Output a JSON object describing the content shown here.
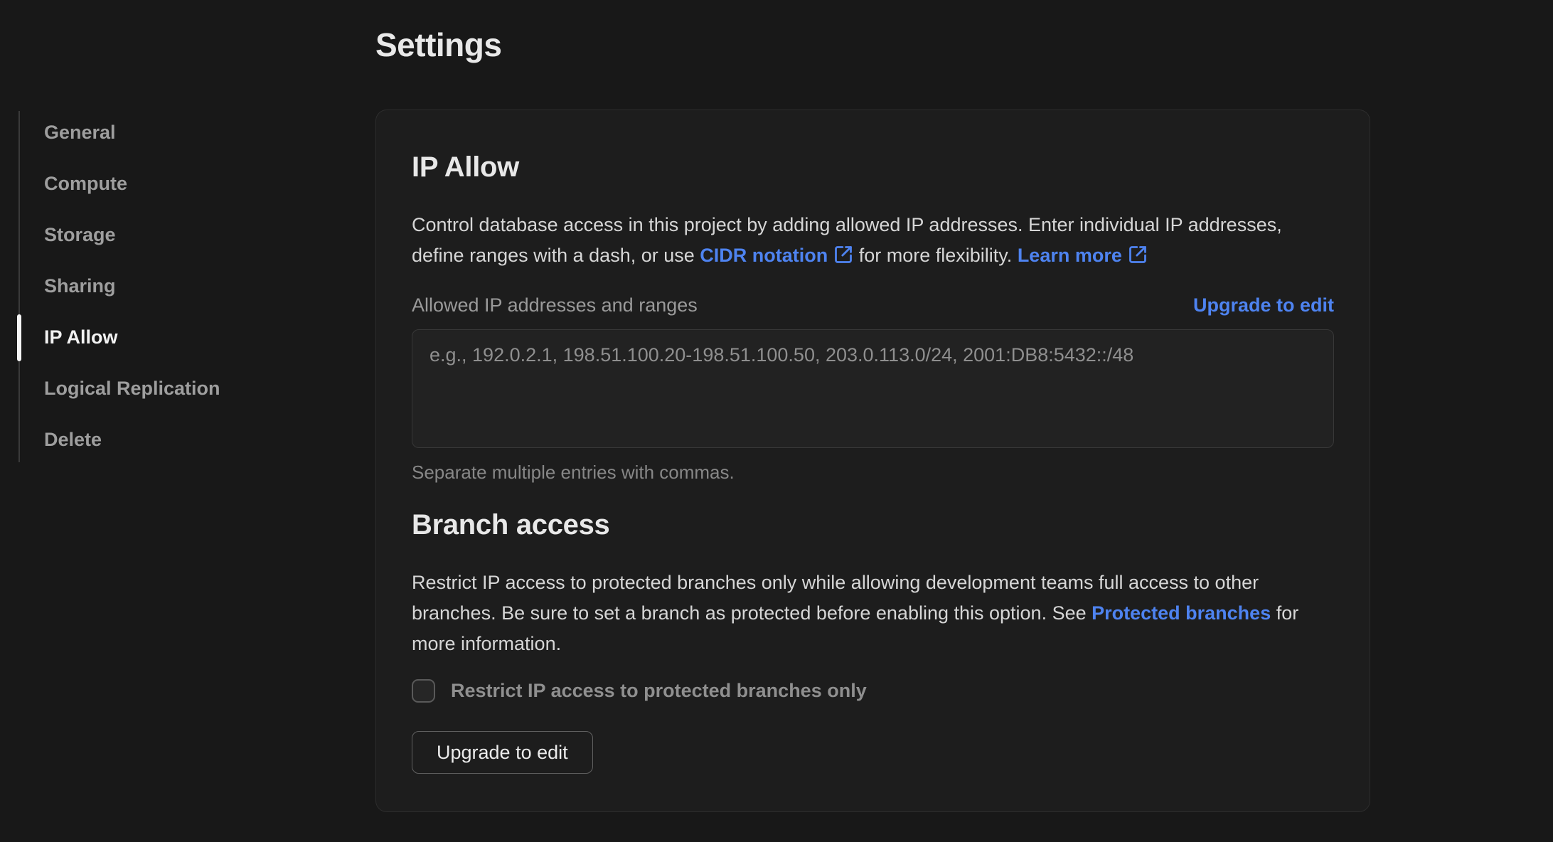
{
  "page": {
    "title": "Settings"
  },
  "colors": {
    "page_background": "#181818",
    "card_background": "#1d1d1d",
    "link_blue": "#4e83f0",
    "active_text": "#f2f2f2",
    "muted_text": "#9a9a9a"
  },
  "sidebar": {
    "items": [
      {
        "label": "General",
        "active": false
      },
      {
        "label": "Compute",
        "active": false
      },
      {
        "label": "Storage",
        "active": false
      },
      {
        "label": "Sharing",
        "active": false
      },
      {
        "label": "IP Allow",
        "active": true
      },
      {
        "label": "Logical Replication",
        "active": false
      },
      {
        "label": "Delete",
        "active": false
      }
    ]
  },
  "ip_allow": {
    "heading": "IP Allow",
    "desc_part1": "Control database access in this project by adding allowed IP addresses. Enter individual IP addresses, define ranges with a dash, or use ",
    "cidr_link": "CIDR notation",
    "cidr_icon": "external-link-icon",
    "desc_part2": " for more flexibility. ",
    "learn_more_link": "Learn more",
    "learn_more_icon": "external-link-icon",
    "field_label": "Allowed IP addresses and ranges",
    "upgrade_link": "Upgrade to edit",
    "textarea_placeholder": "e.g., 192.0.2.1, 198.51.100.20-198.51.100.50, 203.0.113.0/24, 2001:DB8:5432::/48",
    "textarea_value": "",
    "helper": "Separate multiple entries with commas."
  },
  "branch_access": {
    "heading": "Branch access",
    "desc_part1": "Restrict IP access to protected branches only while allowing development teams full access to other branches. Be sure to set a branch as protected before enabling this option. See ",
    "protected_link": "Protected branches",
    "desc_part2": " for more information.",
    "checkbox_label": "Restrict IP access to protected branches only",
    "checkbox_checked": false,
    "button_label": "Upgrade to edit"
  }
}
